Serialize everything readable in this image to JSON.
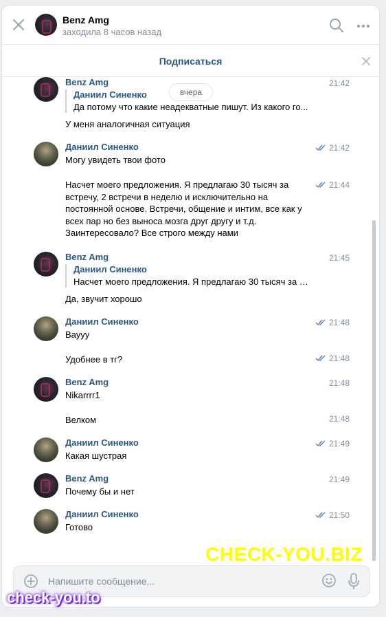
{
  "header": {
    "name": "Benz Amg",
    "status": "заходила 8 часов назад"
  },
  "subscribe": {
    "label": "Подписаться"
  },
  "date_separator": "вчера",
  "messages": [
    {
      "author": "Benz Amg",
      "time": "21:42",
      "quote_author": "Даниил Синенко",
      "quote_text": "Да потому что какие неадекватные пишут. Из какого го...",
      "text": "У меня аналогичная ситуация",
      "read": false
    },
    {
      "author": "Даниил Синенко",
      "time": "21:42",
      "text": "Могу увидеть твои фото",
      "read": true
    },
    {
      "time": "21:44",
      "text": "Насчет моего предложения. Я предлагаю 30 тысяч за встречу, 2 встречи в неделю и исключительно на постоянной основе. Встречи, общение и интим, все как у всех пар но без выноса мозга друг другу и т.д. Заинтересовало? Все строго между нами",
      "read": true
    },
    {
      "author": "Benz Amg",
      "time": "21:45",
      "quote_author": "Даниил Синенко",
      "quote_text": "Насчет моего предложения. Я предлагаю 30 тысяч за в...",
      "text": "Да, звучит хорошо",
      "read": false
    },
    {
      "author": "Даниил Синенко",
      "time": "21:48",
      "text": "Вауyy",
      "read": true
    },
    {
      "time": "21:48",
      "text": "Удобнее в тг?",
      "read": true
    },
    {
      "author": "Benz Amg",
      "time": "21:48",
      "text": "Nikarrrr1",
      "read": false
    },
    {
      "time": "21:48",
      "text": "Велком",
      "read": false
    },
    {
      "author": "Даниил Синенко",
      "time": "21:49",
      "text": "Какая шустрая",
      "read": true
    },
    {
      "author": "Benz Amg",
      "time": "21:49",
      "text": "Почему бы и нет",
      "read": false
    },
    {
      "author": "Даниил Синенко",
      "time": "21:50",
      "text": "Готово",
      "read": true
    }
  ],
  "composer": {
    "placeholder": "Напишите сообщение..."
  },
  "watermarks": {
    "top": "CHECK-YOU.BIZ",
    "bottom": "check-you.to"
  },
  "colors": {
    "accent": "#2a5885",
    "muted": "#818c99",
    "check": "#5181b8",
    "background": "#edeef0"
  }
}
